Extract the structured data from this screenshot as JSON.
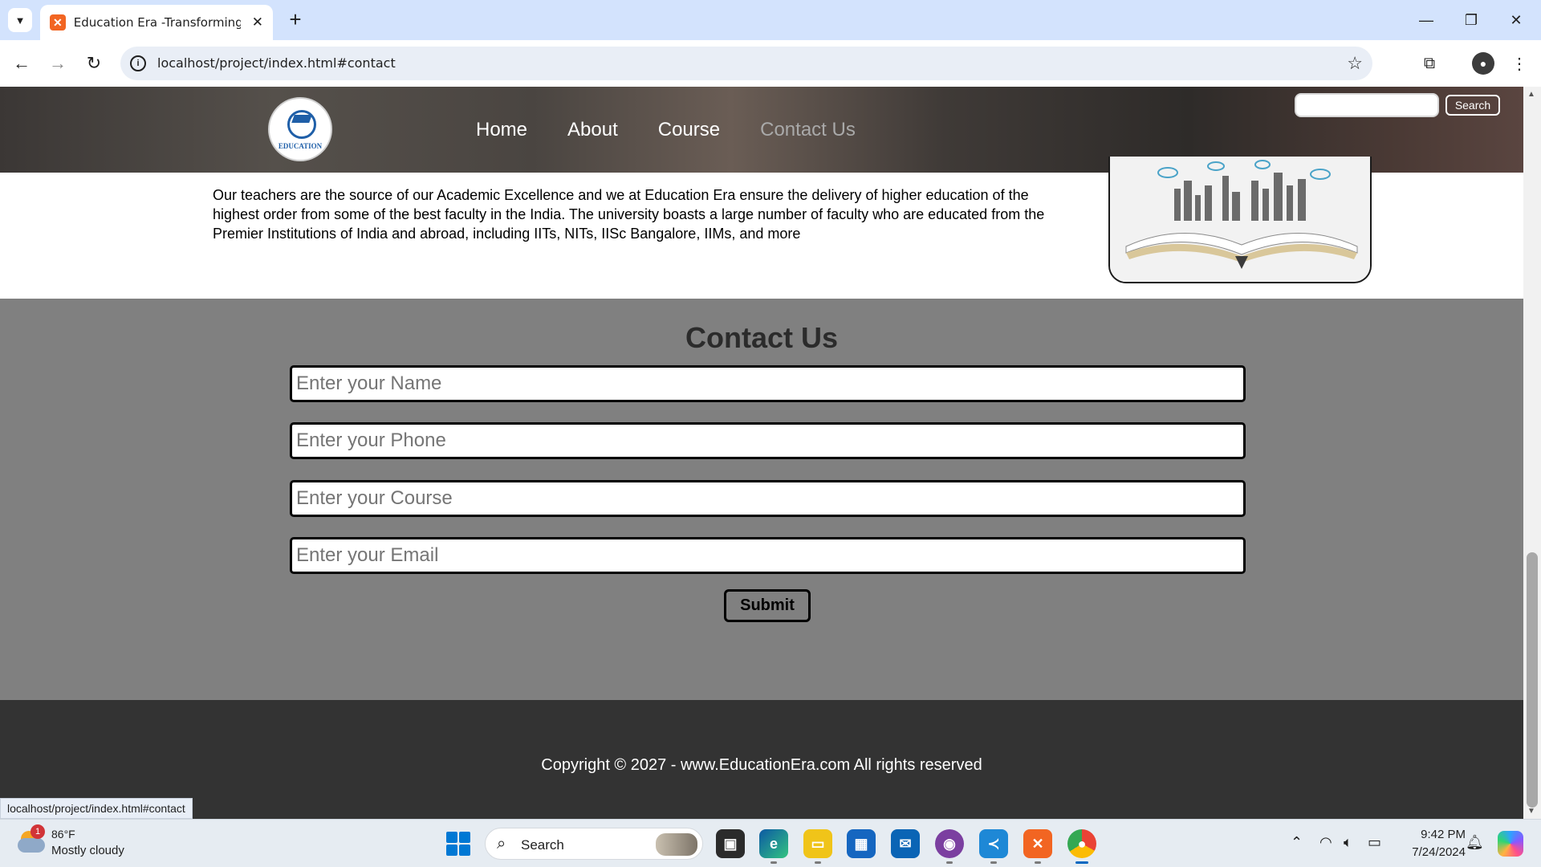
{
  "browser": {
    "tab_title": "Education Era -Transforming Or",
    "tab_favicon": "xampp-icon",
    "url": "localhost/project/index.html#contact",
    "status_url": "localhost/project/index.html#contact"
  },
  "site": {
    "logo_text": "EDUCATION",
    "nav": [
      {
        "label": "Home",
        "active": false
      },
      {
        "label": "About",
        "active": false
      },
      {
        "label": "Course",
        "active": false
      },
      {
        "label": "Contact Us",
        "active": true
      }
    ],
    "search_value": "",
    "search_button": "Search"
  },
  "faculty": {
    "text": "Our teachers are the source of our Academic Excellence and we at Education Era ensure the delivery of higher education of the highest order from some of the best faculty in the India. The university boasts a large number of faculty who are educated from the Premier Institutions of India and abroad, including IITs, NITs, IISc Bangalore, IIMs, and more"
  },
  "contact": {
    "title": "Contact Us",
    "fields": [
      {
        "placeholder": "Enter your Name",
        "value": ""
      },
      {
        "placeholder": "Enter your Phone",
        "value": ""
      },
      {
        "placeholder": "Enter your Course",
        "value": ""
      },
      {
        "placeholder": "Enter your Email",
        "value": ""
      }
    ],
    "submit_label": "Submit"
  },
  "footer": {
    "text": "Copyright © 2027 - www.EducationEra.com All rights reserved"
  },
  "taskbar": {
    "weather_badge": "1",
    "weather_temp": "86°F",
    "weather_desc": "Mostly cloudy",
    "search_label": "Search",
    "apps": [
      "task-view-icon",
      "edge-icon",
      "file-explorer-icon",
      "store-icon",
      "mail-icon",
      "github-desktop-icon",
      "vscode-icon",
      "xampp-icon",
      "chrome-icon"
    ],
    "time": "9:42 PM",
    "date": "7/24/2024"
  },
  "colors": {
    "contact_bg": "#808080",
    "footer_bg": "#333333",
    "nav_active": "#a9a9a9",
    "tabbar_bg": "#d3e3fd"
  }
}
